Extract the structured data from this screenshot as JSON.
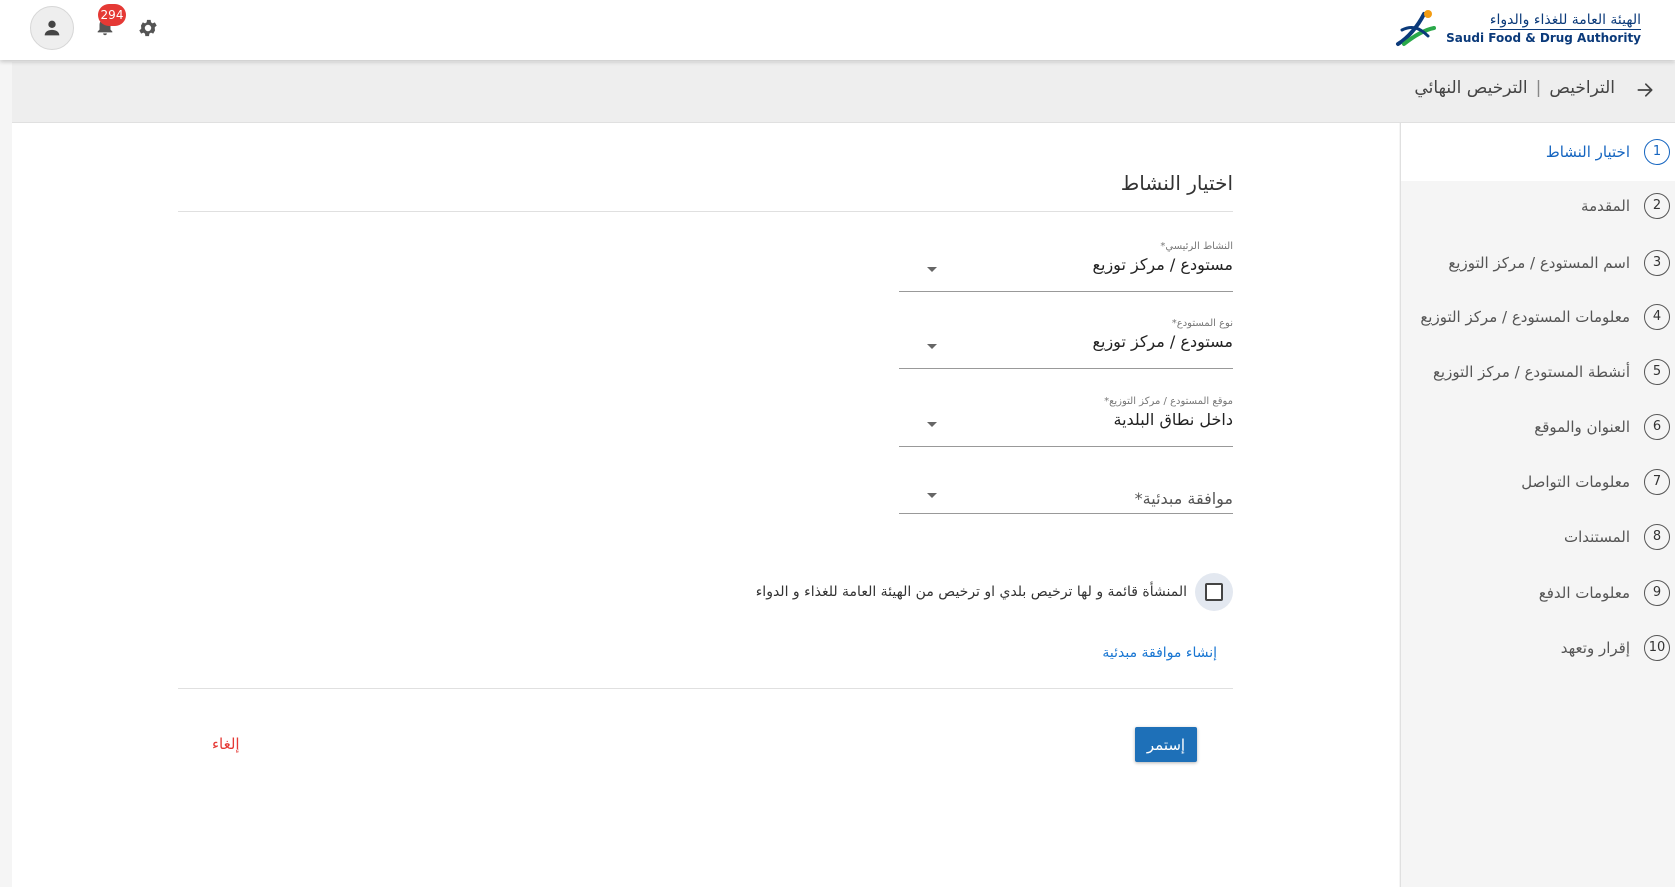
{
  "header": {
    "logo_ar": "الهيئة العامة للغذاء والدواء",
    "logo_en": "Saudi Food & Drug Authority",
    "notification_count": "294"
  },
  "breadcrumb": {
    "root": "التراخيص",
    "separator": "|",
    "current": "الترخيص النهائي"
  },
  "stepper": {
    "active_index": 0,
    "steps": [
      {
        "num": "1",
        "label": "اختيار النشاط"
      },
      {
        "num": "2",
        "label": "المقدمة"
      },
      {
        "num": "3",
        "label": "اسم المستودع / مركز التوزيع"
      },
      {
        "num": "4",
        "label": "معلومات المستودع / مركز التوزيع"
      },
      {
        "num": "5",
        "label": "أنشطة المستودع / مركز التوزيع"
      },
      {
        "num": "6",
        "label": "العنوان والموقع"
      },
      {
        "num": "7",
        "label": "معلومات التواصل"
      },
      {
        "num": "8",
        "label": "المستندات"
      },
      {
        "num": "9",
        "label": "معلومات الدفع"
      },
      {
        "num": "10",
        "label": "إقرار وتعهد"
      }
    ]
  },
  "form": {
    "title": "اختيار النشاط",
    "main_activity": {
      "label": "النشاط الرئيسي*",
      "value": "مستودع / مركز توزيع"
    },
    "warehouse_type": {
      "label": "نوع المستودع*",
      "value": "مستودع / مركز توزيع"
    },
    "warehouse_location": {
      "label": "موقع المستودع / مركز التوزيع*",
      "value": "داخل نطاق البلدية"
    },
    "preliminary_approval": {
      "placeholder": "موافقة مبدئية*"
    },
    "existing_facility_checkbox": {
      "label": "المنشأة قائمة و لها ترخيص بلدي او ترخيص من الهيئة العامة للغذاء و الدواء",
      "checked": false
    },
    "create_approval_link": "إنشاء موافقة مبدئية",
    "continue_label": "إستمر",
    "cancel_label": "إلغاء"
  },
  "colors": {
    "primary": "#1e70b8",
    "link": "#1976d2",
    "cancel": "#e53935",
    "badge": "#e53935"
  }
}
